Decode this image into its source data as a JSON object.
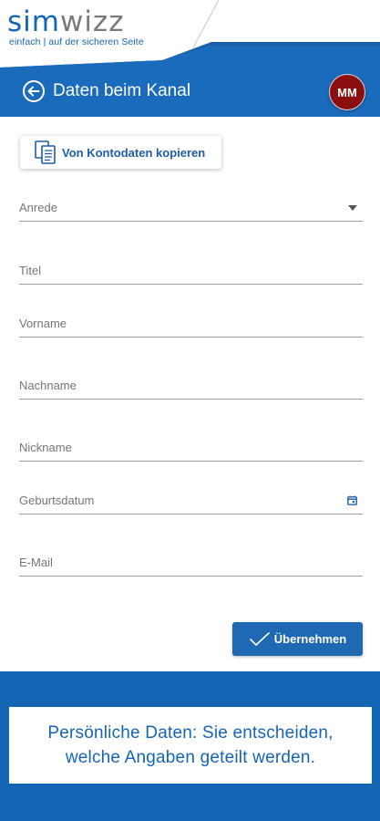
{
  "brand": {
    "logo_part1": "sim",
    "logo_part2": "wizz",
    "tagline": "einfach | auf der sicheren Seite",
    "primary_color": "#1565b5",
    "avatar_color": "#8c0f0f"
  },
  "header": {
    "back_icon": "arrow-left-circle-icon",
    "title": "Daten beim Kanal",
    "avatar_initials": "MM"
  },
  "copy_button": {
    "icon": "copy-documents-icon",
    "label": "Von Kontodaten kopieren"
  },
  "form": {
    "salutation": {
      "label": "Anrede",
      "icon": "dropdown-arrow-icon"
    },
    "title": {
      "label": "Titel"
    },
    "first_name": {
      "label": "Vorname"
    },
    "last_name": {
      "label": "Nachname"
    },
    "nickname": {
      "label": "Nickname"
    },
    "birthdate": {
      "label": "Geburtsdatum",
      "icon": "calendar-icon"
    },
    "email": {
      "label": "E-Mail"
    }
  },
  "submit": {
    "icon": "checkmark-icon",
    "label": "Übernehmen"
  },
  "banner": {
    "line1": "Persönliche Daten: Sie entscheiden,",
    "line2": "welche Angaben geteilt werden."
  }
}
